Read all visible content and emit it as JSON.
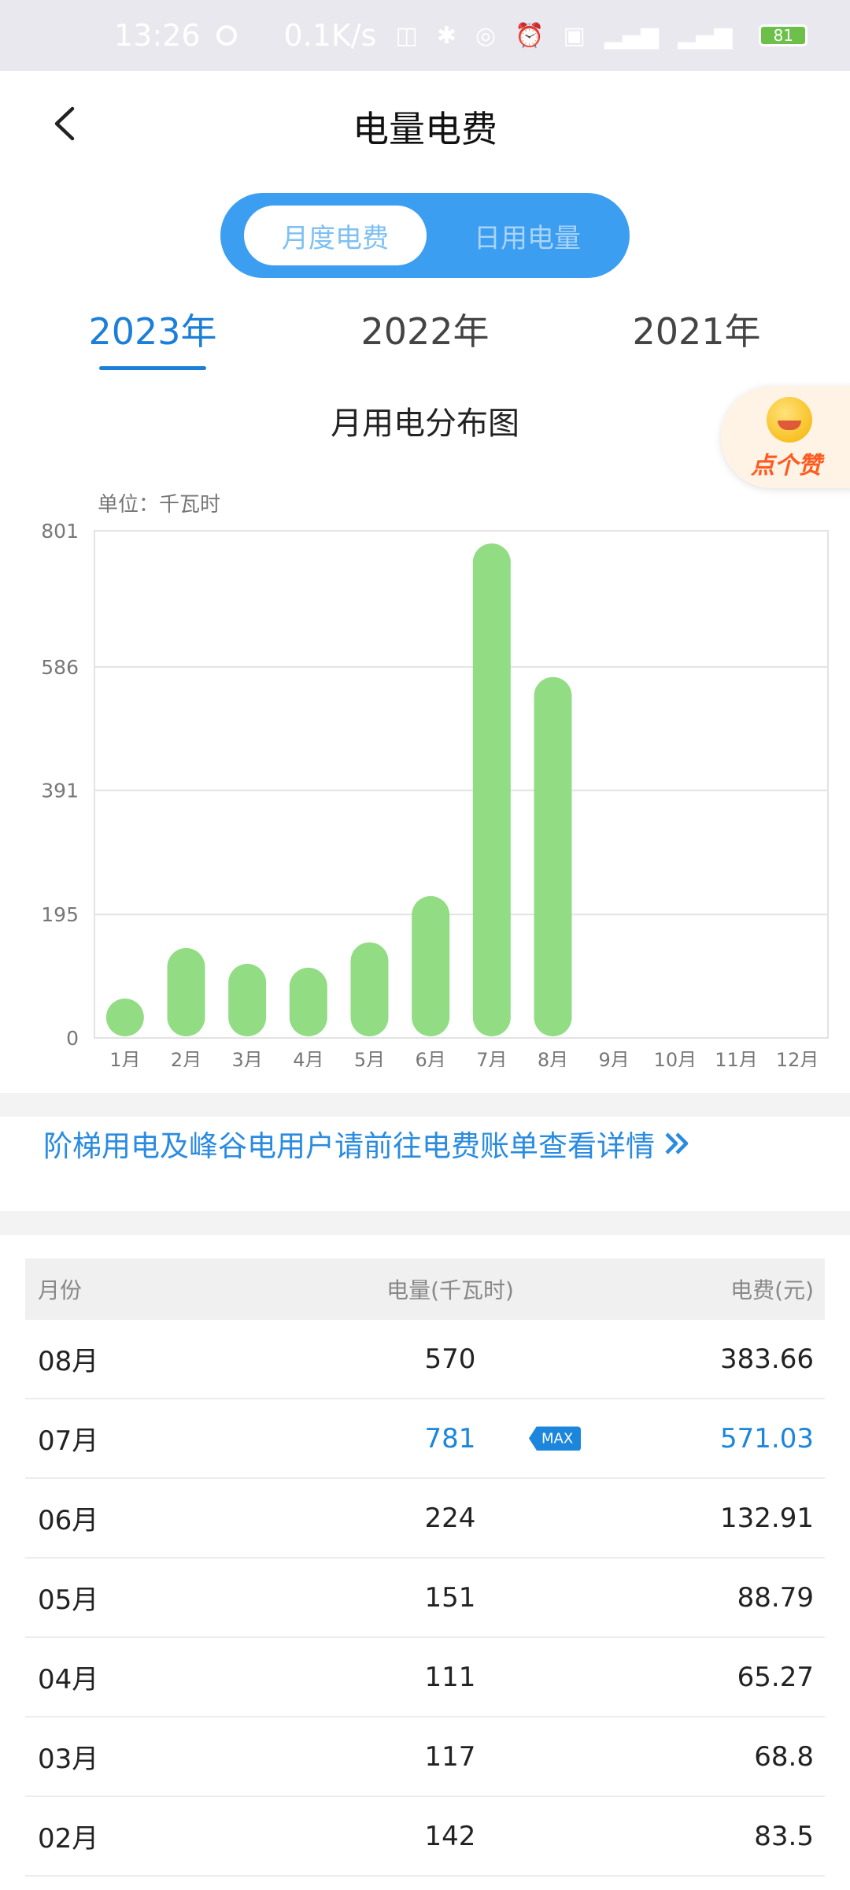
{
  "status_bar": {
    "time": "13:26",
    "net_speed": "0.1K/s",
    "battery": "81"
  },
  "header": {
    "title": "电量电费"
  },
  "segment": {
    "active": "月度电费",
    "inactive": "日用电量"
  },
  "years": [
    "2023年",
    "2022年",
    "2021年"
  ],
  "like_label": "点个赞",
  "chart": {
    "title": "月用电分布图",
    "unit": "单位：千瓦时"
  },
  "chart_data": {
    "type": "bar",
    "categories": [
      "1月",
      "2月",
      "3月",
      "4月",
      "5月",
      "6月",
      "7月",
      "8月",
      "9月",
      "10月",
      "11月",
      "12月"
    ],
    "values": [
      43,
      142,
      117,
      111,
      151,
      224,
      781,
      570,
      null,
      null,
      null,
      null
    ],
    "y_ticks": [
      0,
      195,
      391,
      586,
      801
    ],
    "ylim": [
      0,
      801
    ],
    "bar_color": "#92dc84",
    "grid": true
  },
  "notice": "阶梯用电及峰谷电用户请前往电费账单查看详情",
  "table": {
    "headers": {
      "month": "月份",
      "kwh": "电量(千瓦时)",
      "fee": "电费(元)"
    },
    "max_badge": "MAX",
    "rows": [
      {
        "month": "08月",
        "kwh": "570",
        "fee": "383.66"
      },
      {
        "month": "07月",
        "kwh": "781",
        "fee": "571.03",
        "max": true
      },
      {
        "month": "06月",
        "kwh": "224",
        "fee": "132.91"
      },
      {
        "month": "05月",
        "kwh": "151",
        "fee": "88.79"
      },
      {
        "month": "04月",
        "kwh": "111",
        "fee": "65.27"
      },
      {
        "month": "03月",
        "kwh": "117",
        "fee": "68.8"
      },
      {
        "month": "02月",
        "kwh": "142",
        "fee": "83.5"
      }
    ]
  },
  "colors": {
    "accent": "#1b7ed8",
    "segment_bg": "#3c9ef0",
    "bar": "#92dc84"
  }
}
